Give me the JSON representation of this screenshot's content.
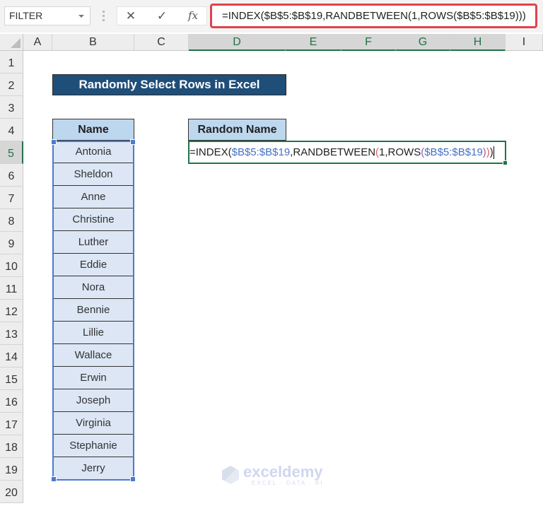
{
  "formula_bar": {
    "name_box": "FILTER",
    "cancel_icon": "✕",
    "enter_icon": "✓",
    "fx_label": "fx",
    "formula": "=INDEX($B$5:$B$19,RANDBETWEEN(1,ROWS($B$5:$B$19)))"
  },
  "columns": [
    "A",
    "B",
    "C",
    "D",
    "E",
    "F",
    "G",
    "H",
    "I"
  ],
  "rows": [
    "1",
    "2",
    "3",
    "4",
    "5",
    "6",
    "7",
    "8",
    "9",
    "10",
    "11",
    "12",
    "13",
    "14",
    "15",
    "16",
    "17",
    "18",
    "19",
    "20"
  ],
  "sheet": {
    "title": "Randomly Select Rows in Excel",
    "name_header": "Name",
    "random_header": "Random Name",
    "names": [
      "Antonia",
      "Sheldon",
      "Anne",
      "Christine",
      "Luther",
      "Eddie",
      "Nora",
      "Bennie",
      "Lillie",
      "Wallace",
      "Erwin",
      "Joseph",
      "Virginia",
      "Stephanie",
      "Jerry"
    ],
    "active_cell_formula": {
      "prefix": "=INDEX(",
      "ref1": "$B$5:$B$19",
      "mid1": ",RANDBETWEEN",
      "open1": "(",
      "mid2": "1,ROWS",
      "open2": "(",
      "ref2": "$B$5:$B$19",
      "close2": ")",
      "close1": ")",
      "close0": ")"
    }
  },
  "watermark": {
    "brand": "exceldemy",
    "tagline": "EXCEL · DATA · BI"
  },
  "colors": {
    "title_bg": "#1f4e79",
    "header_bg": "#bdd7ee",
    "cell_bg": "#dce6f4",
    "accent": "#217346",
    "formula_border": "#e0434a"
  }
}
